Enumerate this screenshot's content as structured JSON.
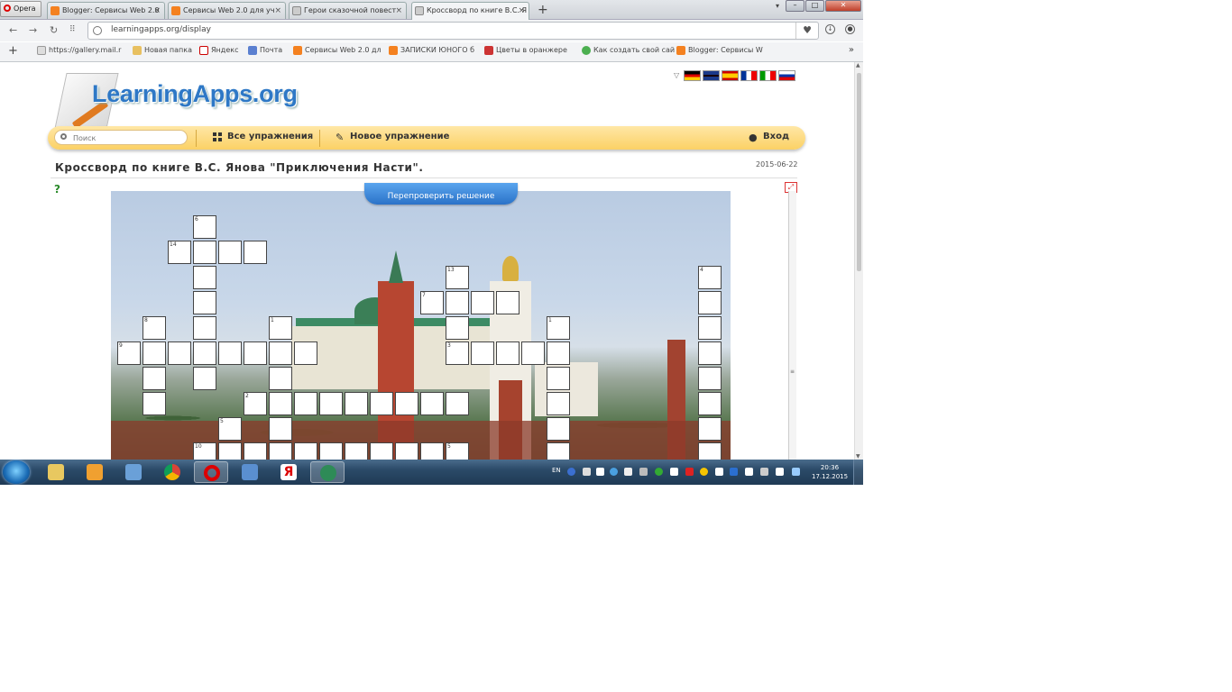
{
  "browser": {
    "menu_label": "Opera",
    "tabs": [
      {
        "label": "Blogger: Сервисы Web 2.0"
      },
      {
        "label": "Сервисы Web 2.0 для уч"
      },
      {
        "label": "Герои сказочной повест"
      },
      {
        "label": "Кроссворд по книге В.С. Я"
      }
    ],
    "url": "learningapps.org/display",
    "bookmarks": [
      {
        "label": "https://gallery.mail.r"
      },
      {
        "label": "Новая папка"
      },
      {
        "label": "Яндекс"
      },
      {
        "label": "Почта"
      },
      {
        "label": "Сервисы Web 2.0 дл"
      },
      {
        "label": "ЗАПИСКИ ЮНОГО б"
      },
      {
        "label": "Цветы в оранжере"
      },
      {
        "label": "Как создать свой сай"
      },
      {
        "label": "Blogger: Сервисы W"
      }
    ]
  },
  "site": {
    "logo_text": "LearningApps.org",
    "search_placeholder": "Поиск",
    "nav": {
      "all_exercises": "Все упражнения",
      "new_exercise": "Новое упражнение",
      "login": "Вход"
    },
    "flags": [
      "de",
      "en",
      "es",
      "fr",
      "it",
      "ru"
    ]
  },
  "exercise": {
    "title": "Кроссворд по книге В.С. Янова \"Приключения Насти\".",
    "date": "2015-06-22",
    "check_button": "Перепроверить решение"
  },
  "taskbar": {
    "lang": "EN",
    "time": "20:36",
    "date": "17.12.2015"
  },
  "crossword_numbers": [
    "6",
    "14",
    "13",
    "7",
    "4",
    "8",
    "1",
    "1",
    "9",
    "3",
    "2",
    "5",
    "10",
    "5"
  ]
}
